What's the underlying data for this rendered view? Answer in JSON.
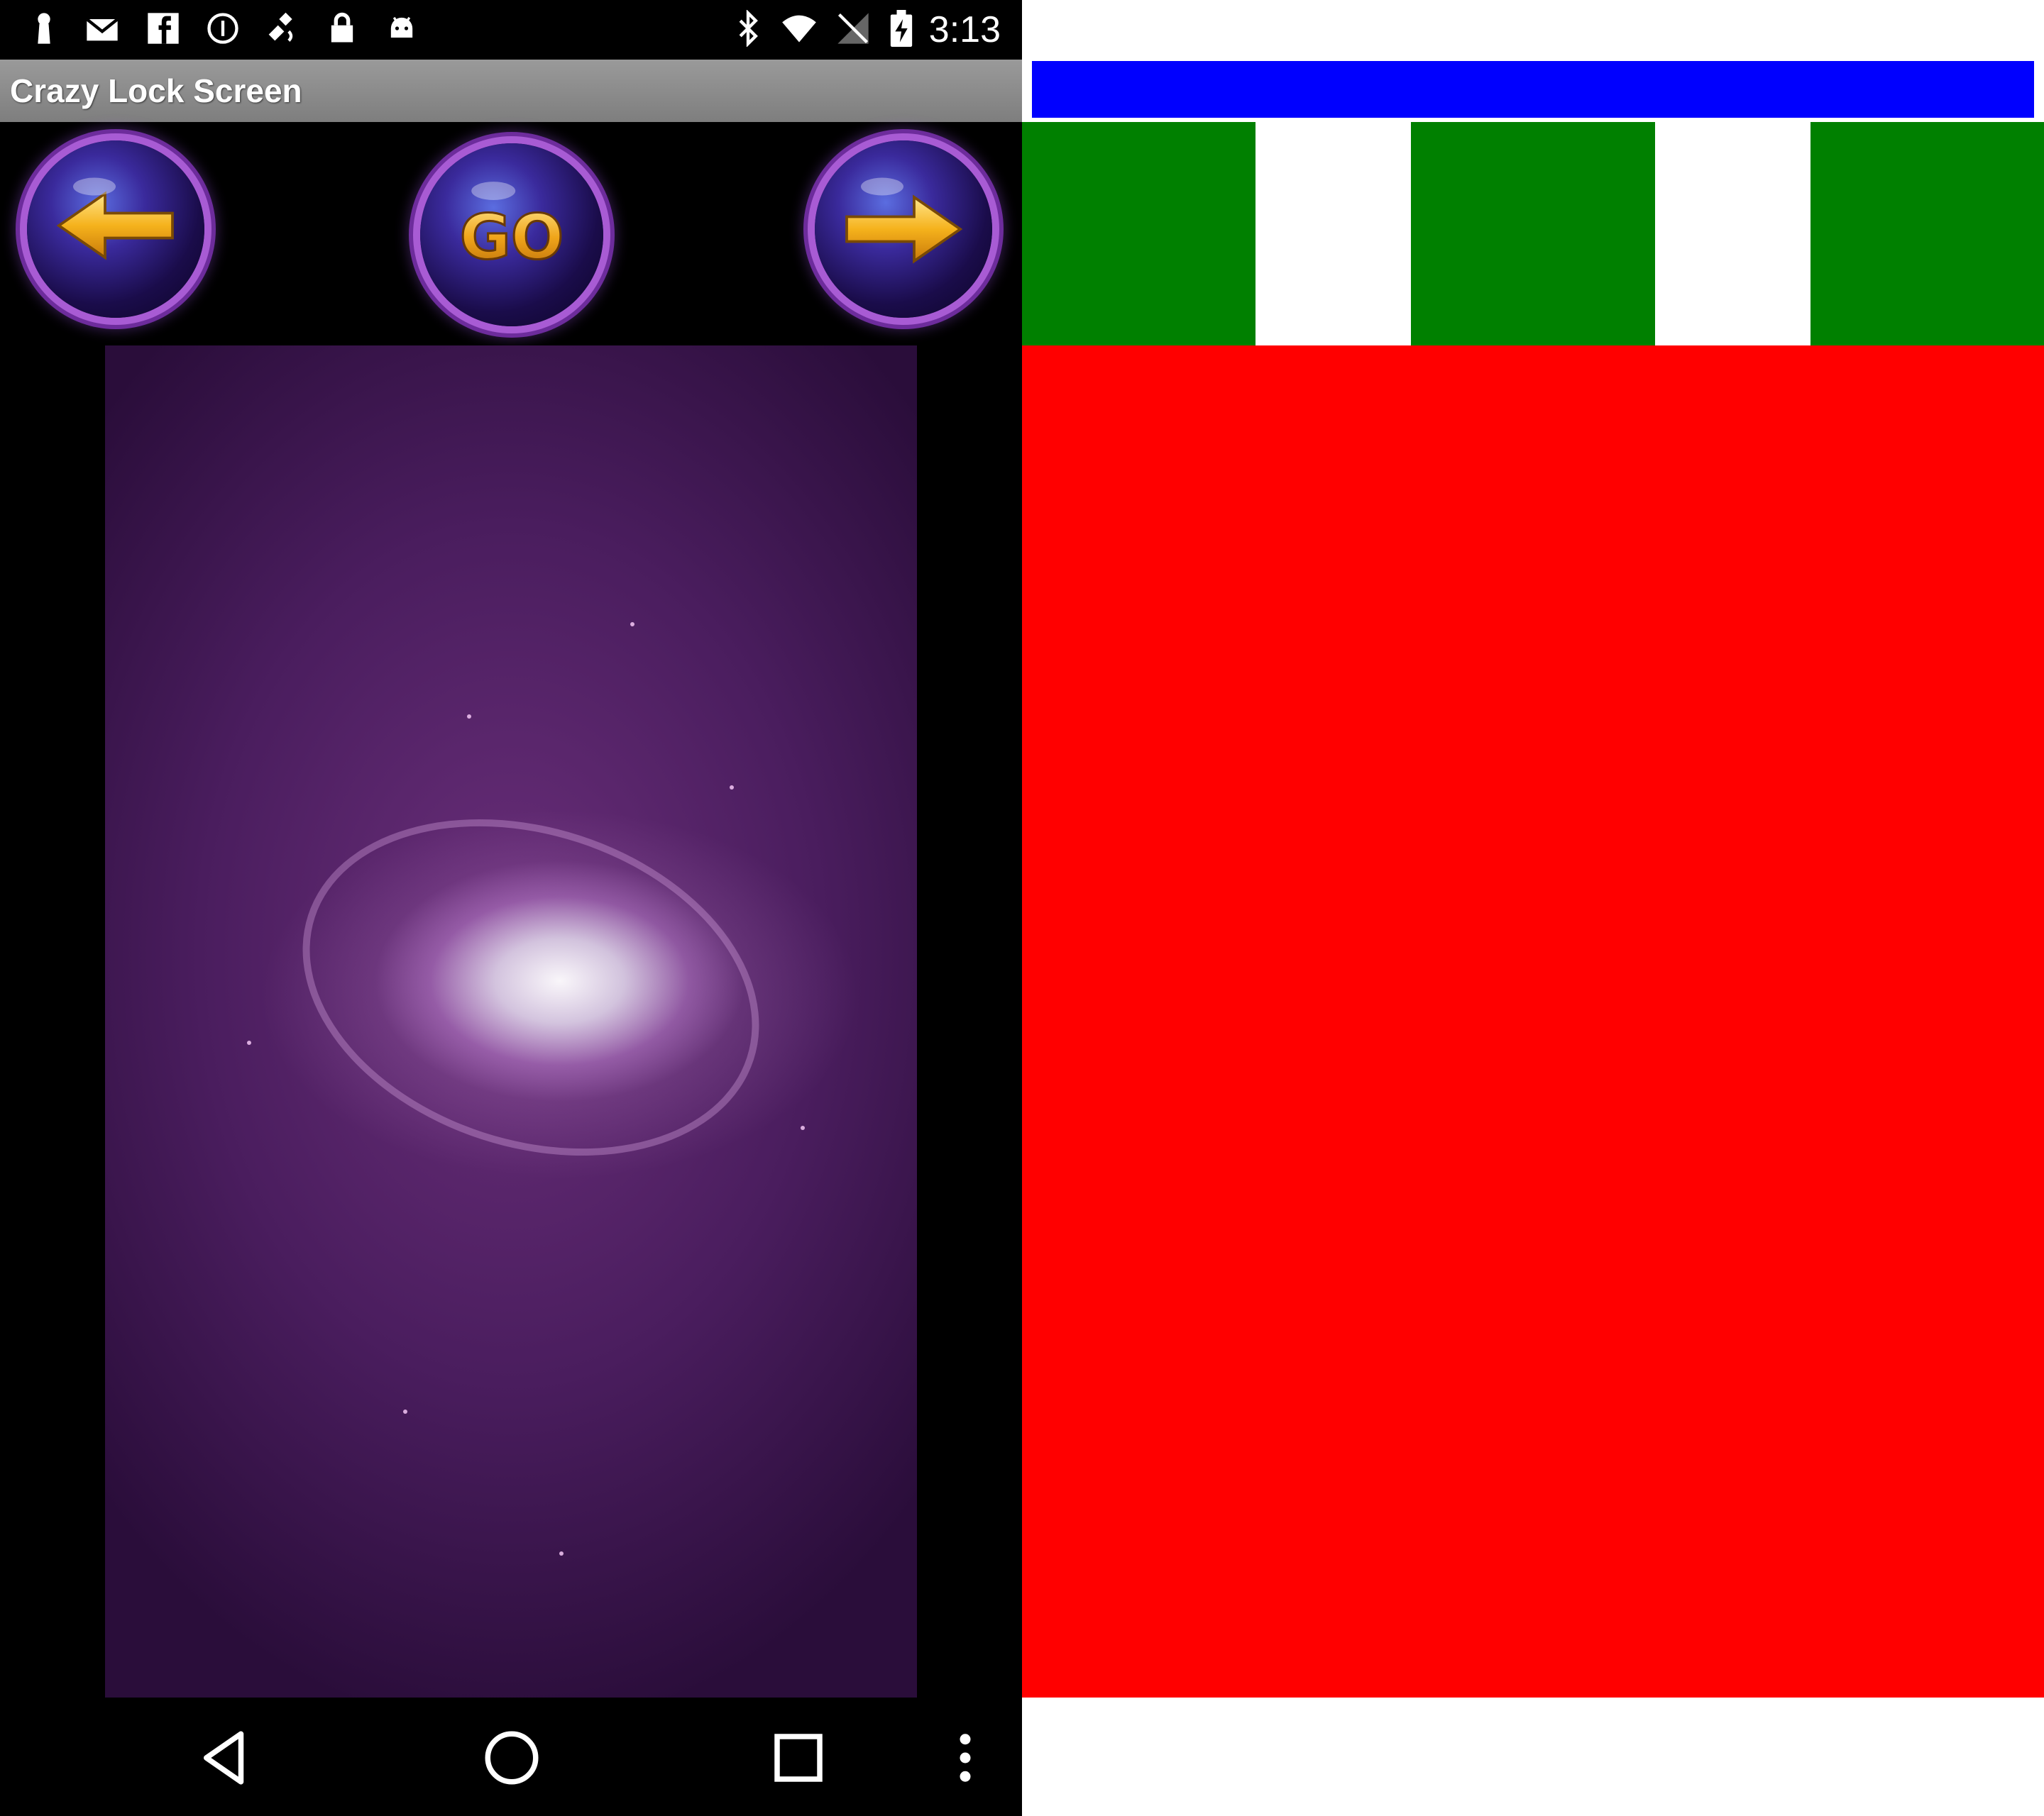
{
  "status_bar": {
    "time": "3:13",
    "left_icons": [
      "keyhole-icon",
      "mail-icon",
      "facebook-icon",
      "info-circle-icon",
      "fake-gps-icon",
      "lock-icon",
      "android-icon"
    ],
    "right_icons": [
      "bluetooth-icon",
      "wifi-icon",
      "no-signal-icon",
      "battery-charging-icon"
    ]
  },
  "app": {
    "title": "Crazy Lock Screen"
  },
  "toolbar": {
    "prev_icon": "arrow-left-icon",
    "go_label": "GO",
    "next_icon": "arrow-right-icon"
  },
  "wallpaper": {
    "description_icon": "galaxy-wallpaper-image"
  },
  "nav_bar": {
    "icons": [
      "back-icon",
      "home-icon",
      "recents-icon",
      "overflow-menu-icon"
    ]
  },
  "debug_layout": {
    "colors": {
      "blue": "#0000ff",
      "green": "#008000",
      "red": "#ff0000",
      "white": "#ffffff"
    }
  }
}
